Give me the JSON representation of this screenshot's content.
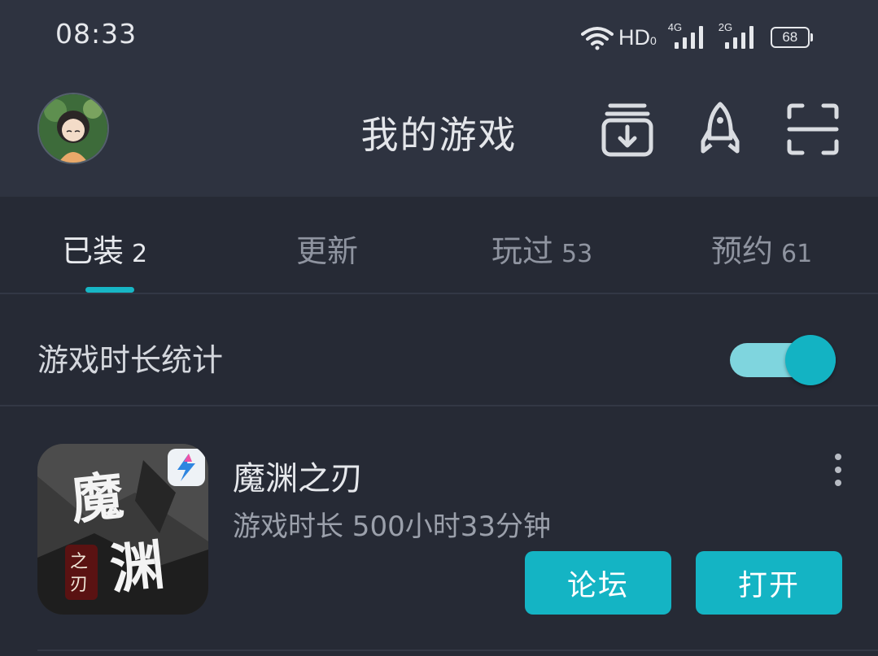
{
  "status_bar": {
    "time": "08:33",
    "network_label": "HD",
    "network_sub": "0",
    "signal_1": "4G",
    "signal_2": "2G",
    "battery": "68"
  },
  "header": {
    "title": "我的游戏",
    "icons": [
      "download-icon",
      "rocket-icon",
      "scan-icon"
    ]
  },
  "tabs": [
    {
      "label": "已装",
      "count": "2",
      "active": true
    },
    {
      "label": "更新",
      "count": "",
      "active": false
    },
    {
      "label": "玩过",
      "count": "53",
      "active": false
    },
    {
      "label": "预约",
      "count": "61",
      "active": false
    }
  ],
  "playtime_stats": {
    "label": "游戏时长统计",
    "enabled": true
  },
  "games": [
    {
      "name": "魔渊之刃",
      "playtime": "游戏时长 500小时33分钟",
      "icon_text": "魔渊之刃",
      "forum_label": "论坛",
      "open_label": "打开"
    }
  ],
  "colors": {
    "accent": "#14b4c4",
    "background": "#262a35",
    "header_bg": "#2e3340"
  }
}
